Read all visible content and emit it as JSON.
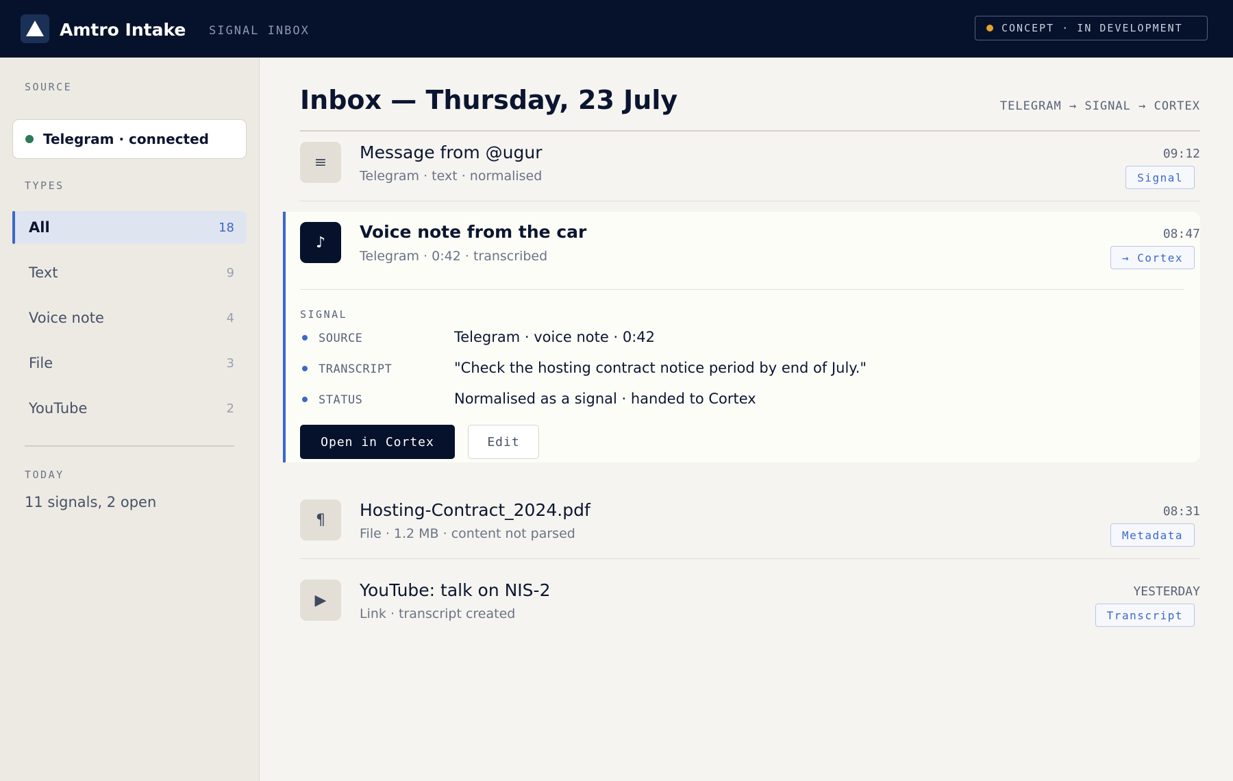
{
  "app": {
    "title": "Amtro Intake",
    "section": "SIGNAL INBOX",
    "status_badge": "CONCEPT · IN DEVELOPMENT",
    "logo_icon": "triangle-logo-icon",
    "colors": {
      "topbar": "#06122b",
      "accent": "#3b68c9",
      "status_dot": "#e3a230",
      "connected_dot": "#2c7a5a"
    }
  },
  "sidebar": {
    "source_label": "SOURCE",
    "source_status": "Telegram · connected",
    "types_label": "TYPES",
    "types": [
      {
        "label": "All",
        "count": "18",
        "active": true
      },
      {
        "label": "Text",
        "count": "9"
      },
      {
        "label": "Voice note",
        "count": "4"
      },
      {
        "label": "File",
        "count": "3"
      },
      {
        "label": "YouTube",
        "count": "2"
      }
    ],
    "today_label": "TODAY",
    "today_summary": "11 signals, 2 open"
  },
  "main": {
    "title": "Inbox — Thursday, 23 July",
    "flow": "TELEGRAM → SIGNAL → CORTEX",
    "messages": [
      {
        "icon": "≡",
        "icon_name": "text-lines-icon",
        "title": "Message from @ugur",
        "subtitle": "Telegram · text · normalised",
        "time": "09:12",
        "tag": "Signal"
      },
      {
        "icon": "♪",
        "icon_name": "music-note-icon",
        "title": "Voice note from the car",
        "subtitle": "Telegram · 0:42 · transcribed",
        "time": "08:47",
        "tag": "→ Cortex",
        "expanded": true
      },
      {
        "icon": "¶",
        "icon_name": "paragraph-icon",
        "title": "Hosting-Contract_2024.pdf",
        "subtitle": "File · 1.2 MB · content not parsed",
        "time": "08:31",
        "tag": "Metadata"
      },
      {
        "icon": "▶",
        "icon_name": "play-icon",
        "title": "YouTube: talk on NIS-2",
        "subtitle": "Link · transcript created",
        "time": "YESTERDAY",
        "tag": "Transcript"
      }
    ],
    "signal": {
      "label": "SIGNAL",
      "rows": [
        {
          "key": "SOURCE",
          "value": "Telegram · voice note · 0:42"
        },
        {
          "key": "TRANSCRIPT",
          "value": "\"Check the hosting contract notice period by end of July.\""
        },
        {
          "key": "STATUS",
          "value": "Normalised as a signal · handed to Cortex"
        }
      ],
      "primary_button": "Open in Cortex",
      "secondary_button": "Edit"
    }
  }
}
